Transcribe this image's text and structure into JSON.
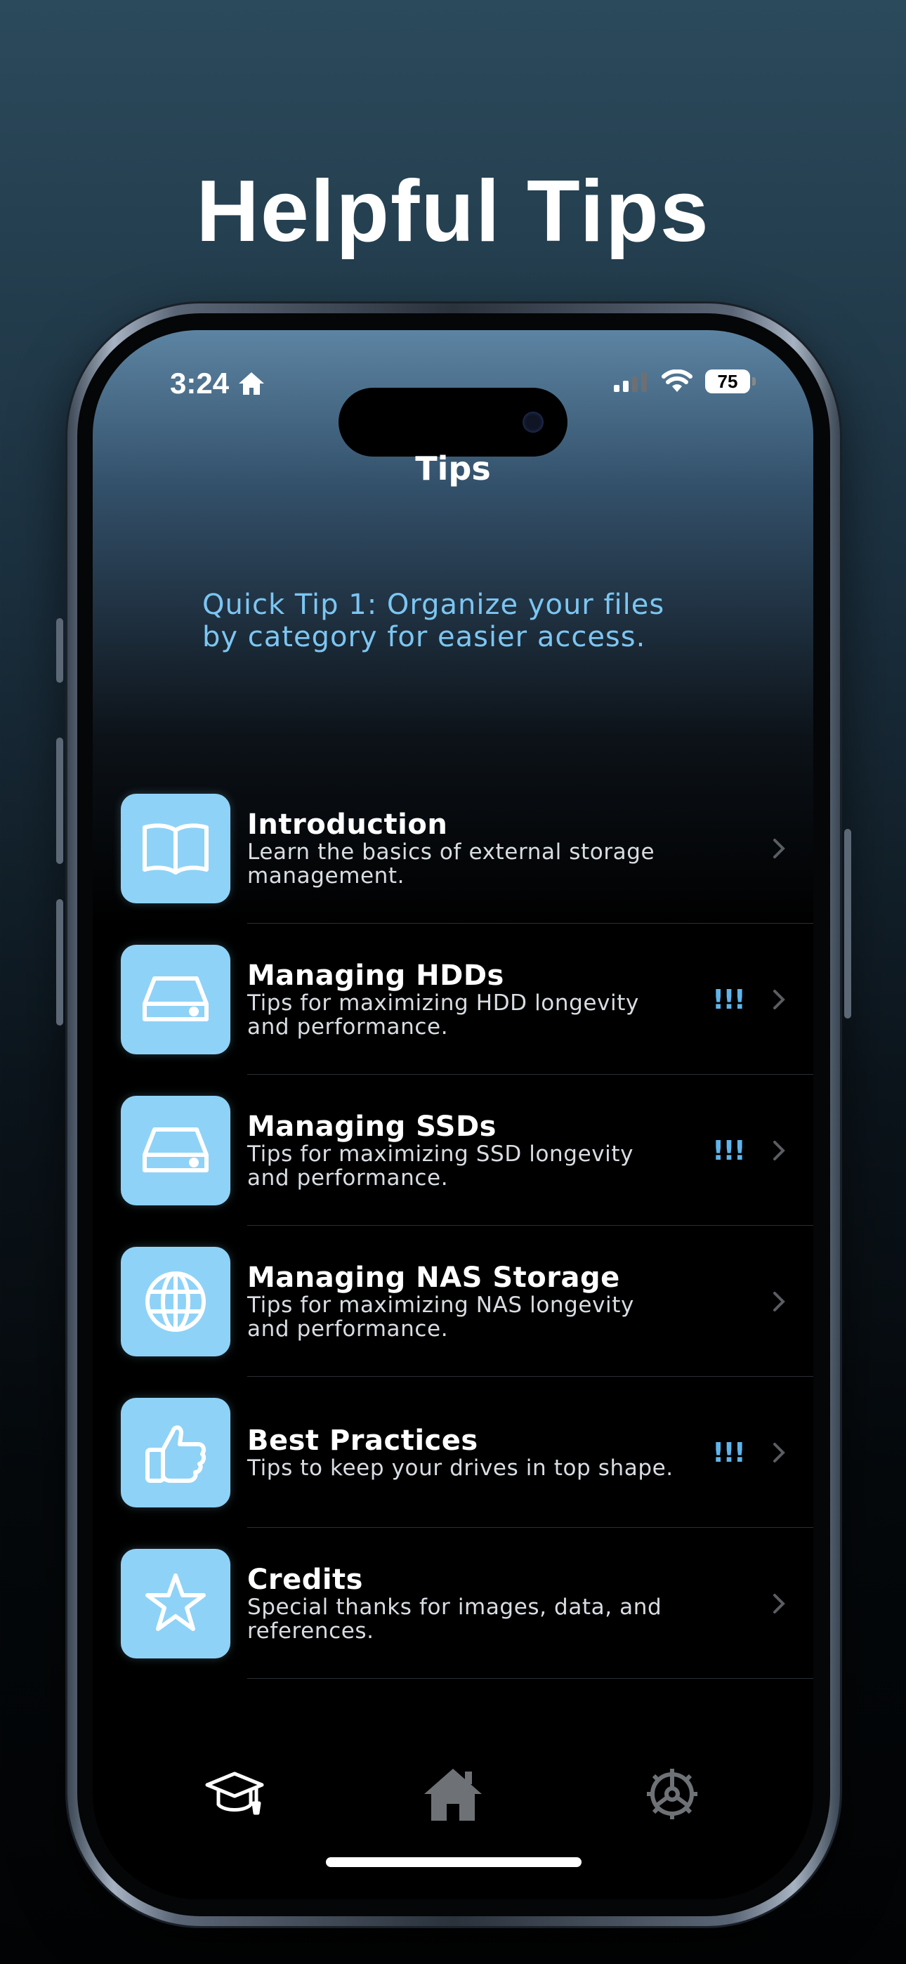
{
  "headline": "Helpful Tips",
  "status_bar": {
    "time": "3:24",
    "battery": "75"
  },
  "nav": {
    "title": "Tips"
  },
  "quick_tip": "Quick Tip 1: Organize your files by category for easier access.",
  "items": [
    {
      "title": "Introduction",
      "subtitle": "Learn the basics of external storage management.",
      "icon": "book-icon",
      "badge": ""
    },
    {
      "title": "Managing HDDs",
      "subtitle": "Tips for maximizing HDD longevity and performance.",
      "icon": "drive-icon",
      "badge": "!!!"
    },
    {
      "title": "Managing SSDs",
      "subtitle": "Tips for maximizing SSD longevity and performance.",
      "icon": "drive-icon",
      "badge": "!!!"
    },
    {
      "title": "Managing NAS Storage",
      "subtitle": "Tips for maximizing NAS longevity and performance.",
      "icon": "globe-icon",
      "badge": ""
    },
    {
      "title": "Best Practices",
      "subtitle": "Tips to keep your drives in top shape.",
      "icon": "thumbs-up-icon",
      "badge": "!!!"
    },
    {
      "title": "Credits",
      "subtitle": "Special thanks for images, data, and references.",
      "icon": "star-icon",
      "badge": ""
    }
  ],
  "tabs": [
    {
      "name": "graduation-cap-icon",
      "selected": true
    },
    {
      "name": "house-icon",
      "selected": false
    },
    {
      "name": "gear-icon",
      "selected": false
    }
  ],
  "colors": {
    "accent": "#8fd2f7",
    "tip_text": "#7cc6f2",
    "badge": "#5fb4ea"
  }
}
